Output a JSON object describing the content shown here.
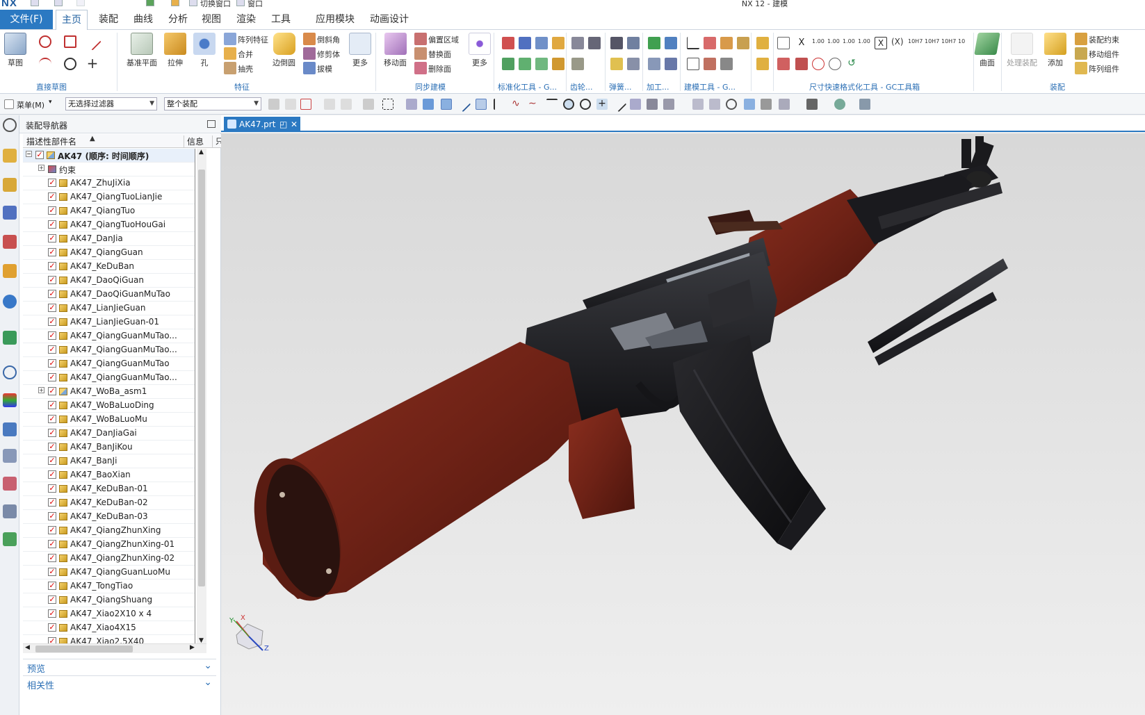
{
  "app": {
    "logo": "NX",
    "window_title": "NX 12 - 建模",
    "quick_access": [
      "切换窗口",
      "窗口"
    ]
  },
  "menu_tabs": [
    "主页",
    "装配",
    "曲线",
    "分析",
    "视图",
    "渲染",
    "工具",
    "应用模块",
    "动画设计"
  ],
  "file_tab": "文件(F)",
  "active_tab": "主页",
  "ribbon": {
    "groups": [
      "直接草图",
      "特征",
      "同步建模",
      "标准化工具 - G...",
      "齿轮...",
      "弹簧...",
      "加工...",
      "建模工具 - G...",
      "尺寸快速格式化工具 - GC工具箱",
      "装配"
    ],
    "big_buttons": [
      "草图",
      "基准平面",
      "拉伸",
      "孔",
      "边倒圆",
      "更多",
      "移动面",
      "更多",
      "曲面",
      "处理装配",
      "添加"
    ],
    "feature_items": [
      "阵列特征",
      "合并",
      "抽壳",
      "倒斜角",
      "修剪体",
      "拔模"
    ],
    "sync_items": [
      "偏置区域",
      "替换面",
      "删除面"
    ],
    "assembly_items": [
      "装配约束",
      "移动组件",
      "阵列组件"
    ],
    "dim_labels": [
      "1.00",
      "1.00",
      "1.00",
      "1.00",
      "10H7",
      "10H7",
      "10H7",
      "10"
    ]
  },
  "selection_bar": {
    "menu_label": "菜单(M)",
    "filter_value": "无选择过滤器",
    "scope_value": "整个装配"
  },
  "navigator": {
    "title": "装配导航器",
    "columns": [
      "描述性部件名",
      "信息",
      "只"
    ],
    "root": "AK47 (顺序: 时间顺序)",
    "constraints": "约束",
    "parts": [
      "AK47_ZhuJiXia",
      "AK47_QiangTuoLianJie",
      "AK47_QiangTuo",
      "AK47_QiangTuoHouGai",
      "AK47_DanJia",
      "AK47_QiangGuan",
      "AK47_KeDuBan",
      "AK47_DaoQiGuan",
      "AK47_DaoQiGuanMuTao",
      "AK47_LianJieGuan",
      "AK47_LianJieGuan-01",
      "AK47_QiangGuanMuTao...",
      "AK47_QiangGuanMuTao...",
      "AK47_QiangGuanMuTao",
      "AK47_QiangGuanMuTao...",
      "AK47_WoBa_asm1",
      "AK47_WoBaLuoDing",
      "AK47_WoBaLuoMu",
      "AK47_DanJiaGai",
      "AK47_BanJiKou",
      "AK47_BanJi",
      "AK47_BaoXian",
      "AK47_KeDuBan-01",
      "AK47_KeDuBan-02",
      "AK47_KeDuBan-03",
      "AK47_QiangZhunXing",
      "AK47_QiangZhunXing-01",
      "AK47_QiangZhunXing-02",
      "AK47_QiangGuanLuoMu",
      "AK47_TongTiao",
      "AK47_QiangShuang",
      "AK47_Xiao2X10 x 4",
      "AK47_Xiao4X15",
      "AK47_Xiao2.5X40"
    ],
    "subassembly_index": 15,
    "sections": [
      "预览",
      "相关性"
    ]
  },
  "document_tab": "AK47.prt",
  "triad": {
    "x": "X",
    "y": "Y",
    "z": "Z"
  },
  "colors": {
    "accent": "#2b79c2",
    "wood": "#7a2a1c",
    "metal": "#1c1d20",
    "viewport_top": "#d8d8d8",
    "viewport_bottom": "#efefef"
  }
}
